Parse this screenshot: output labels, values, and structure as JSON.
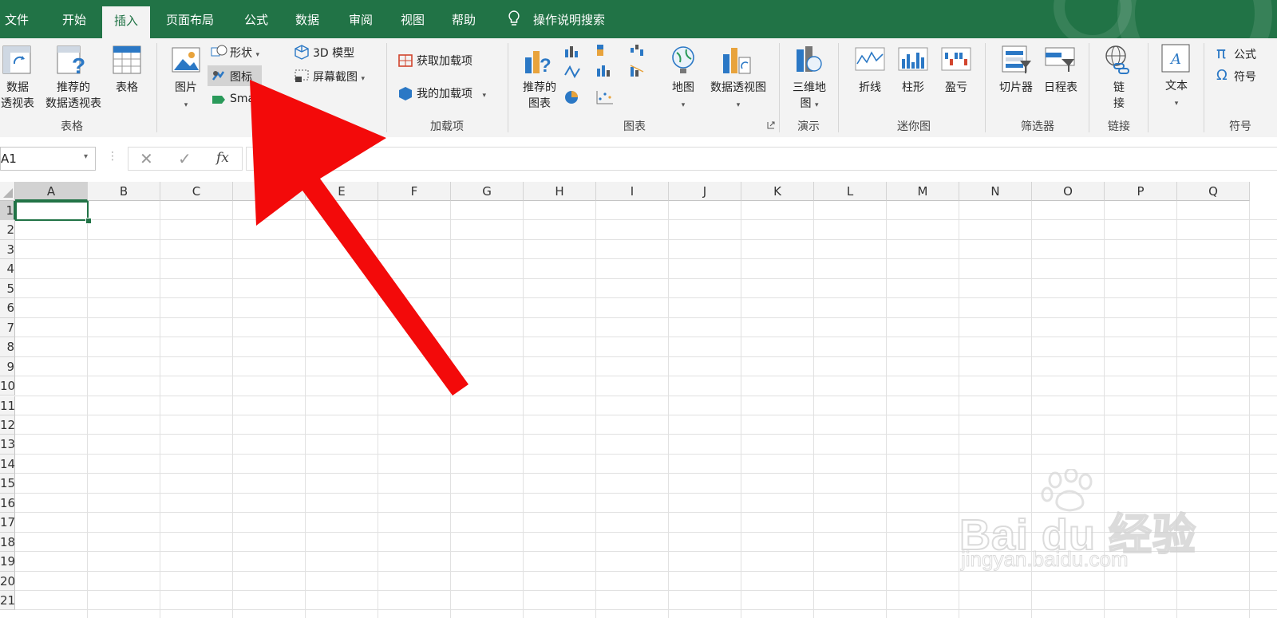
{
  "tabs": [
    {
      "label": "文件"
    },
    {
      "label": "开始"
    },
    {
      "label": "插入",
      "active": true
    },
    {
      "label": "页面布局"
    },
    {
      "label": "公式"
    },
    {
      "label": "数据"
    },
    {
      "label": "审阅"
    },
    {
      "label": "视图"
    },
    {
      "label": "帮助"
    }
  ],
  "tell_me": "操作说明搜索",
  "ribbon": {
    "tables": {
      "pivot": "数据\n透视表",
      "recommended_pivot": "推荐的\n数据透视表",
      "table": "表格",
      "group": "表格"
    },
    "illustrations": {
      "pictures": "图片",
      "shapes": "形状",
      "icons": "图标",
      "smartart": "Sma",
      "model3d": "3D 模型",
      "screenshot": "屏幕截图"
    },
    "addins": {
      "get": "获取加载项",
      "mine": "我的加载项",
      "group": "加载项"
    },
    "charts": {
      "recommended": "推荐的\n图表",
      "map": "地图",
      "pivot_chart": "数据透视图",
      "group": "图表"
    },
    "tours": {
      "map3d": "三维地\n图",
      "group": "演示"
    },
    "sparklines": {
      "line": "折线",
      "column": "柱形",
      "winloss": "盈亏",
      "group": "迷你图"
    },
    "filters": {
      "slicer": "切片器",
      "timeline": "日程表",
      "group": "筛选器"
    },
    "links": {
      "link": "链\n接",
      "group": "链接"
    },
    "text": {
      "text": "文本",
      "group": ""
    },
    "symbols": {
      "equation": "公式",
      "symbol": "符号",
      "group": "符号"
    }
  },
  "formula_bar": {
    "name_box": "A1",
    "fx": "fx",
    "content": ""
  },
  "columns": [
    "A",
    "B",
    "C",
    "D",
    "E",
    "F",
    "G",
    "H",
    "I",
    "J",
    "K",
    "L",
    "M",
    "N",
    "O",
    "P",
    "Q"
  ],
  "rows": [
    "1",
    "2",
    "3",
    "4",
    "5",
    "6",
    "7",
    "8",
    "9",
    "10",
    "11",
    "12",
    "13",
    "14",
    "15",
    "16",
    "17",
    "18",
    "19",
    "20",
    "21"
  ],
  "selected_cell": "A1",
  "watermark": {
    "brand": "Bai du 经验",
    "url": "jingyan.baidu.com"
  },
  "colors": {
    "brand": "#217346",
    "arrow": "#f30a0a"
  }
}
